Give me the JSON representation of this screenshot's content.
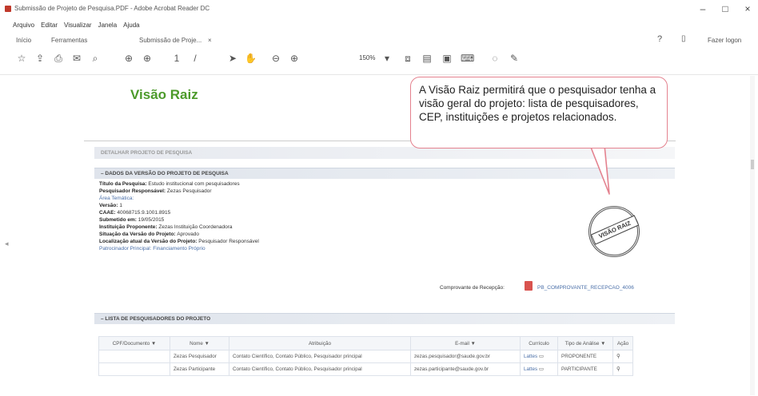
{
  "window": {
    "title": "Submissão de Projeto de Pesquisa.PDF - Adobe Acrobat Reader DC",
    "controls": [
      "–",
      "□",
      "×"
    ]
  },
  "menu": [
    "Arquivo",
    "Editar",
    "Visualizar",
    "Janela",
    "Ajuda"
  ],
  "nav": {
    "home": "Início",
    "tools": "Ferramentas",
    "document_tab": "Submissão de Proje...",
    "close_tab": "×",
    "signin": "Fazer logon"
  },
  "toolbar": {
    "zoom": "150%",
    "icons": [
      "bookmark-icon",
      "upload-icon",
      "print-icon",
      "email-icon",
      "search-icon",
      "zoom-in-icon",
      "zoom-out-icon",
      "page-up-icon",
      "page-down-icon",
      "select-cursor-icon",
      "hand-icon",
      "minus-zoom-icon",
      "plus-zoom-icon",
      "fit-page-icon",
      "read-mode-icon",
      "scroll-icon",
      "keyboard-icon",
      "comment-icon",
      "pen-icon"
    ]
  },
  "page": {
    "heading": "Visão Raiz",
    "callout": "A Visão Raiz permitirá que o pesquisador tenha a visão geral do projeto: lista de pesquisadores, CEP, instituições e projetos relacionados.",
    "stamp": "VISÃO RAIZ"
  },
  "document": {
    "banner": "DETALHAR PROJETO DE PESQUISA",
    "section1": "–   DADOS DA VERSÃO DO PROJETO DE PESQUISA",
    "details": [
      {
        "label": "Título da Pesquisa:",
        "value": "Estudo institucional com pesquisadores"
      },
      {
        "label": "Pesquisador Responsável:",
        "value": "Zezas Pesquisador"
      },
      {
        "label": "Área Temática:",
        "value": ""
      },
      {
        "label": "Versão:",
        "value": "1"
      },
      {
        "label": "CAAE:",
        "value": "40068715.9.1001.8915"
      },
      {
        "label": "Submetido em:",
        "value": "19/05/2015"
      },
      {
        "label": "Instituição Proponente:",
        "value": "Zezas Instituição Coordenadora"
      },
      {
        "label": "Situação da Versão do Projeto:",
        "value": "Aprovado"
      },
      {
        "label": "Localização atual da Versão do Projeto:",
        "value": "Pesquisador Responsável"
      },
      {
        "label": "Patrocinador Principal:",
        "value": "Financiamento Próprio"
      }
    ],
    "receipt_label": "Comprovante de Recepção:",
    "receipt_file": "PB_COMPROVANTE_RECEPCAO_4006"
  },
  "researchers": {
    "section": "–   LISTA DE PESQUISADORES DO PROJETO",
    "headers": [
      "CPF/Documento ▼",
      "Nome ▼",
      "Atribuição",
      "E-mail ▼",
      "Currículo",
      "Tipo de Análise ▼",
      "Ação"
    ],
    "rows": [
      {
        "cpf": "",
        "name": "Zezas Pesquisador",
        "role": "Contato Científico, Contato Público, Pesquisador principal",
        "email": "zezas.pesquisador@saude.gov.br",
        "cv": "Lattes",
        "type": "PROPONENTE"
      },
      {
        "cpf": "",
        "name": "Zezas Participante",
        "role": "Contato Científico, Contato Público, Pesquisador principal",
        "email": "zezas.participante@saude.gov.br",
        "cv": "Lattes",
        "type": "PARTICIPANTE"
      }
    ]
  }
}
